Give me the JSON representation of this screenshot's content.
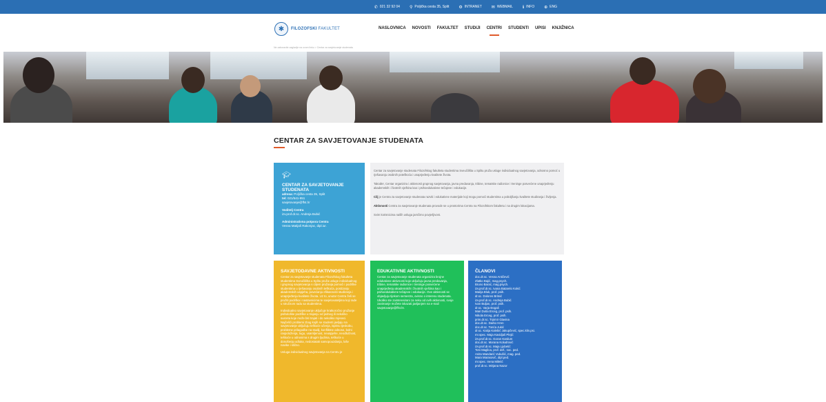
{
  "topbar": {
    "phone": "021 32 92 04",
    "address": "Poljička cesta 35, Split",
    "intranet": "INTRANET",
    "webmail": "WEBMAIL",
    "info": "INFO",
    "lang": "ENG"
  },
  "header": {
    "logo_bold": "FILOZOFSKI",
    "logo_light": "FAKULTET",
    "nav": [
      {
        "label": "NASLOVNICA"
      },
      {
        "label": "NOVOSTI"
      },
      {
        "label": "FAKULTET"
      },
      {
        "label": "STUDIJI"
      },
      {
        "label": "CENTRI"
      },
      {
        "label": "STUDENTI"
      },
      {
        "label": "UPISI"
      },
      {
        "label": "KNJIŽNICA"
      }
    ],
    "active": "CENTRI",
    "accent": "#e05a2a",
    "brand": "#2b6fb4"
  },
  "breadcrumb": "Ne zaboravite zaglavlje na ovom linku > Centar za savjetovanje studenata",
  "page_title": "CENTAR ZA SAVJETOVANJE STUDENATA",
  "info_box": {
    "title": "CENTAR ZA SAVJETOVANJE STUDENATA",
    "address_label": "adresa:",
    "address": "Poljička cesta 35, Split",
    "tel_label": "tel:",
    "tel": "021/541-951",
    "email": "savjetovanje@ffst.hr",
    "head_label": "Voditelj Centra",
    "head": "izv.prof.dr.sc. Andreja Bubić",
    "admin_label": "Administrativna potpora Centra",
    "admin": "Vesna Matijaš Rakonjac, dipl.iur."
  },
  "description": {
    "p1": "Centar za savjetovanje studenata Filozofskog fakulteta studentima Sveučilišta u Splitu pruža usluge individualnog savjetovanja, odnosno pomoć u rješavanju osobnih poteškoća i unaprjeđenju kvalitete života.",
    "p2": "Također, Centar organizira i aktivnosti grupnog savjetovanja, javna predavanja, tribine, tematske radionice i treninge posvećene unaprjeđenju akademskih i životnih vještina kao i psihoedukativne tečajeve i edukacije.",
    "p3_bold": "Cilj",
    "p3": " je Centra za savjetovanje studenata razviti i edukativne materijale koji mogu pomoći studentima u poboljšanju kvalitete studiranja i življenja.",
    "p4_bold": "Aktivnosti",
    "p4": " Centra za savjetovanje studenata provode se u prostorima Centra na Filozofskom fakultetu i na drugim lokacijama.",
    "p5": "Svim korisnicima naših usluga jamčimo povjerljivost."
  },
  "counseling": {
    "title": "SAVJETODAVNE AKTIVNOSTI",
    "p1": "Centar za savjetovanje studenata Filozofskog fakulteta studentima Sveučilišta u Splitu pruža usluge individualnog i grupnog savjetovanja s ciljem pružanja pomoći i podrške studentima u rješavanju osobnih teškoća, postizanju akademskih uspjeha, povećanju efikasnosti studiranja i unaprjeđenju kvalitete života. Uz to, unutar Centra želi se pružiti podrška i nastavnicima te savjetovateljima koji rade u stručnom radu sa studentima.",
    "p2": "Individualno savjetovanje uključuje kratkoročno pružanje psihološke podrške u trajanju od jednog ili nekoliko susreta koje može biti trajati i do nekoliko mjeseci. Najčešći problemi zbog kojih se studenti javljaju na savjetovanje uključuju teškoće učenja, ispitnu tjeskobu, probleme prilagodbe na studij, konfliktne odnose, bolni raspoloženja, tugu, usamljenost, neuspjehe, neodlučnost, teškoće u odnosima s drugim ljudima, teškoće u donošenju odluka, nedostatak samopouzdanja, loše navike i slično.",
    "p3": "Usluga individualnog savjetovanja na Centru je"
  },
  "education": {
    "title": "EDUKATIVNE AKTIVNOSTI",
    "p1": "Centar za savjetovanje studenata organizira brojne edukativne aktivnosti koje uključuju javna predavanja, tribine, tematske radionice i treninge posvećene unaprjeđenju akademskih i životnih vještina kao i psihoedukativne tečajeve i edukacije. Ove aktivnosti se objavljuju tijekom semestra, ovisno o interesu studenata. Ukoliko ste zainteresirani za neku od ovih aktivnosti, svoje zanimanje možete iskazati javljanjem na e-mail savjetovanje@ffst.hr."
  },
  "members": {
    "title": "ČLANOVI",
    "list": [
      "doc.dr.sc. Vesna Antičević",
      "Zlatko Bajić, mag.psych.",
      "Bruno Barać, mag.psych.",
      "izv.prof.dr.sc. Ivana Batarelo Kokić",
      "Marija Bluk, prof. psih.",
      "dr.sc. Dolores Britvić",
      "izv.prof.dr.sc. Andreja Bubić",
      "Ivan Buljan, prof. psih.",
      "dr.sc. Varja Đogaš",
      "Mari Duša Erceg, prof. psih.",
      "Nikola Erceg, prof. psih.",
      "prim.dr.sc. Trpimir Glavina",
      "doc.dr.sc. Darko Hren",
      "doc.dr.sc. Tonća Jukić",
      "dr.sc. Katija Kalebić Jakupčević, spec.klin.psi.",
      "mr.spec. Maja Kavidjaš Plejić",
      "izv.prof.dr.sc. Goran Kardum",
      "doc.dr.sc. Morana Koludrović",
      "izv.prof.dr.sc. Maja Ljubetić",
      "Toni Maglica, prof. def., soc. ped.",
      "Anita Mandarić Vukušić, mag. ped.",
      "Mara Marasović, dipl.ped.",
      "mr.spec. Irena Miletić",
      "prof.dr.sc. Mirjana Nazor"
    ]
  },
  "colors": {
    "info": "#3da3d5",
    "counseling": "#f0b82c",
    "education": "#20c05a",
    "members": "#2c6fc4"
  }
}
